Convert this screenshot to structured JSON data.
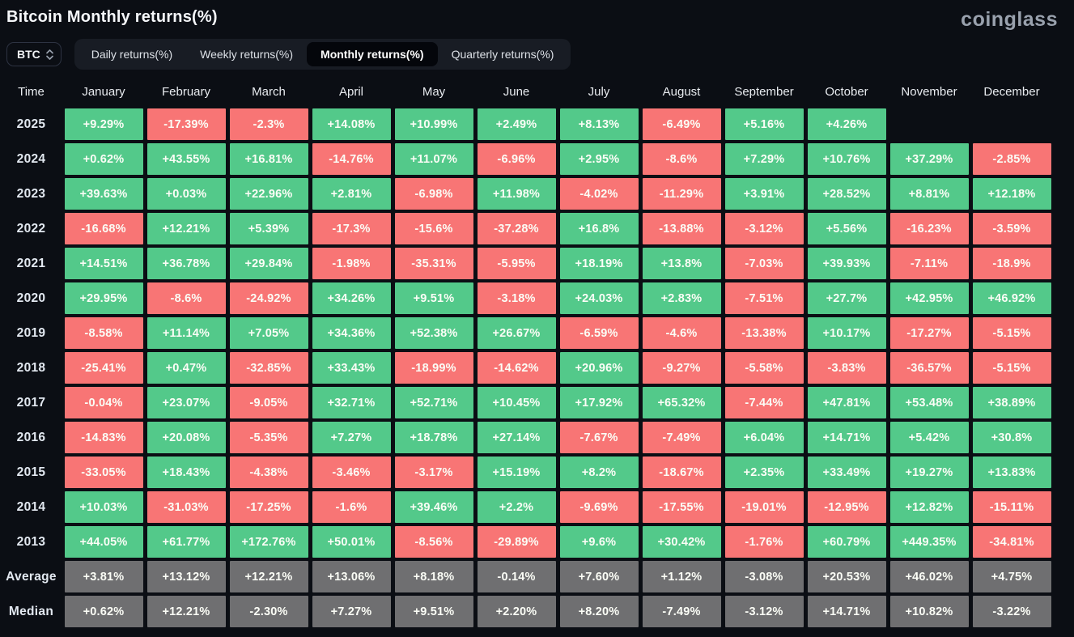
{
  "header": {
    "title": "Bitcoin Monthly returns(%)",
    "logo": "coinglass"
  },
  "toolbar": {
    "symbol_select": {
      "value": "BTC",
      "icon": "chevron-updown-icon"
    },
    "tabs": [
      {
        "id": "daily",
        "label": "Daily returns(%)",
        "active": false
      },
      {
        "id": "weekly",
        "label": "Weekly returns(%)",
        "active": false
      },
      {
        "id": "monthly",
        "label": "Monthly returns(%)",
        "active": true
      },
      {
        "id": "quarterly",
        "label": "Quarterly returns(%)",
        "active": false
      }
    ]
  },
  "table": {
    "time_header": "Time",
    "months": [
      "January",
      "February",
      "March",
      "April",
      "May",
      "June",
      "July",
      "August",
      "September",
      "October",
      "November",
      "December"
    ],
    "rows": [
      {
        "label": "2025",
        "type": "year",
        "values": [
          "+9.29%",
          "-17.39%",
          "-2.3%",
          "+14.08%",
          "+10.99%",
          "+2.49%",
          "+8.13%",
          "-6.49%",
          "+5.16%",
          "+4.26%",
          null,
          null
        ]
      },
      {
        "label": "2024",
        "type": "year",
        "values": [
          "+0.62%",
          "+43.55%",
          "+16.81%",
          "-14.76%",
          "+11.07%",
          "-6.96%",
          "+2.95%",
          "-8.6%",
          "+7.29%",
          "+10.76%",
          "+37.29%",
          "-2.85%"
        ]
      },
      {
        "label": "2023",
        "type": "year",
        "values": [
          "+39.63%",
          "+0.03%",
          "+22.96%",
          "+2.81%",
          "-6.98%",
          "+11.98%",
          "-4.02%",
          "-11.29%",
          "+3.91%",
          "+28.52%",
          "+8.81%",
          "+12.18%"
        ]
      },
      {
        "label": "2022",
        "type": "year",
        "values": [
          "-16.68%",
          "+12.21%",
          "+5.39%",
          "-17.3%",
          "-15.6%",
          "-37.28%",
          "+16.8%",
          "-13.88%",
          "-3.12%",
          "+5.56%",
          "-16.23%",
          "-3.59%"
        ]
      },
      {
        "label": "2021",
        "type": "year",
        "values": [
          "+14.51%",
          "+36.78%",
          "+29.84%",
          "-1.98%",
          "-35.31%",
          "-5.95%",
          "+18.19%",
          "+13.8%",
          "-7.03%",
          "+39.93%",
          "-7.11%",
          "-18.9%"
        ]
      },
      {
        "label": "2020",
        "type": "year",
        "values": [
          "+29.95%",
          "-8.6%",
          "-24.92%",
          "+34.26%",
          "+9.51%",
          "-3.18%",
          "+24.03%",
          "+2.83%",
          "-7.51%",
          "+27.7%",
          "+42.95%",
          "+46.92%"
        ]
      },
      {
        "label": "2019",
        "type": "year",
        "values": [
          "-8.58%",
          "+11.14%",
          "+7.05%",
          "+34.36%",
          "+52.38%",
          "+26.67%",
          "-6.59%",
          "-4.6%",
          "-13.38%",
          "+10.17%",
          "-17.27%",
          "-5.15%"
        ]
      },
      {
        "label": "2018",
        "type": "year",
        "values": [
          "-25.41%",
          "+0.47%",
          "-32.85%",
          "+33.43%",
          "-18.99%",
          "-14.62%",
          "+20.96%",
          "-9.27%",
          "-5.58%",
          "-3.83%",
          "-36.57%",
          "-5.15%"
        ]
      },
      {
        "label": "2017",
        "type": "year",
        "values": [
          "-0.04%",
          "+23.07%",
          "-9.05%",
          "+32.71%",
          "+52.71%",
          "+10.45%",
          "+17.92%",
          "+65.32%",
          "-7.44%",
          "+47.81%",
          "+53.48%",
          "+38.89%"
        ]
      },
      {
        "label": "2016",
        "type": "year",
        "values": [
          "-14.83%",
          "+20.08%",
          "-5.35%",
          "+7.27%",
          "+18.78%",
          "+27.14%",
          "-7.67%",
          "-7.49%",
          "+6.04%",
          "+14.71%",
          "+5.42%",
          "+30.8%"
        ]
      },
      {
        "label": "2015",
        "type": "year",
        "values": [
          "-33.05%",
          "+18.43%",
          "-4.38%",
          "-3.46%",
          "-3.17%",
          "+15.19%",
          "+8.2%",
          "-18.67%",
          "+2.35%",
          "+33.49%",
          "+19.27%",
          "+13.83%"
        ]
      },
      {
        "label": "2014",
        "type": "year",
        "values": [
          "+10.03%",
          "-31.03%",
          "-17.25%",
          "-1.6%",
          "+39.46%",
          "+2.2%",
          "-9.69%",
          "-17.55%",
          "-19.01%",
          "-12.95%",
          "+12.82%",
          "-15.11%"
        ]
      },
      {
        "label": "2013",
        "type": "year",
        "values": [
          "+44.05%",
          "+61.77%",
          "+172.76%",
          "+50.01%",
          "-8.56%",
          "-29.89%",
          "+9.6%",
          "+30.42%",
          "-1.76%",
          "+60.79%",
          "+449.35%",
          "-34.81%"
        ]
      },
      {
        "label": "Average",
        "type": "summary",
        "values": [
          "+3.81%",
          "+13.12%",
          "+12.21%",
          "+13.06%",
          "+8.18%",
          "-0.14%",
          "+7.60%",
          "+1.12%",
          "-3.08%",
          "+20.53%",
          "+46.02%",
          "+4.75%"
        ]
      },
      {
        "label": "Median",
        "type": "summary",
        "values": [
          "+0.62%",
          "+12.21%",
          "-2.30%",
          "+7.27%",
          "+9.51%",
          "+2.20%",
          "+8.20%",
          "-7.49%",
          "-3.12%",
          "+14.71%",
          "+10.82%",
          "-3.22%"
        ]
      }
    ]
  },
  "colors": {
    "positive": "#53c98a",
    "negative": "#f87575",
    "summary": "#6f6f71"
  }
}
